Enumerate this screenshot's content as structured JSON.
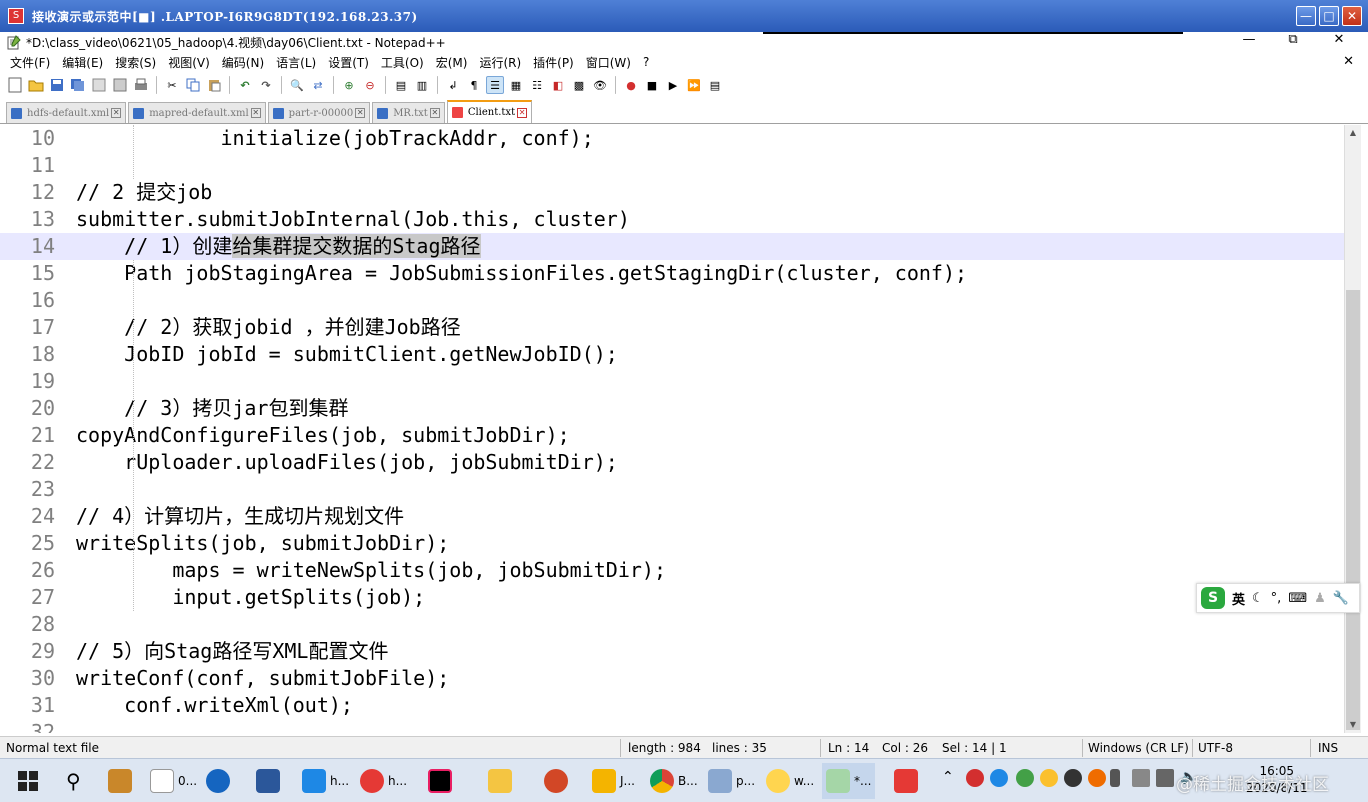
{
  "remote_window": {
    "title": "接收演示或示范中[■] .LAPTOP-I6R9G8DT(192.168.23.37)"
  },
  "window": {
    "title": "*D:\\class_video\\0621\\05_hadoop\\4.视频\\day06\\Client.txt - Notepad++"
  },
  "menu": [
    "文件(F)",
    "编辑(E)",
    "搜索(S)",
    "视图(V)",
    "编码(N)",
    "语言(L)",
    "设置(T)",
    "工具(O)",
    "宏(M)",
    "运行(R)",
    "插件(P)",
    "窗口(W)",
    "?"
  ],
  "tabs": [
    {
      "label": "hdfs-default.xml",
      "active": false
    },
    {
      "label": "mapred-default.xml",
      "active": false
    },
    {
      "label": "part-r-00000",
      "active": false
    },
    {
      "label": "MR.txt",
      "active": false
    },
    {
      "label": "Client.txt",
      "active": true
    }
  ],
  "editor": {
    "lines": [
      {
        "n": "10",
        "text": "            initialize(jobTrackAddr, conf);"
      },
      {
        "n": "11",
        "text": ""
      },
      {
        "n": "12",
        "text": "// 2 提交job"
      },
      {
        "n": "13",
        "text": "submitter.submitJobInternal(Job.this, cluster)"
      },
      {
        "n": "14",
        "pre": "    // 1）创建",
        "sel": "给集群提交数据的Stag路径",
        "post": ""
      },
      {
        "n": "15",
        "text": "    Path jobStagingArea = JobSubmissionFiles.getStagingDir(cluster, conf);"
      },
      {
        "n": "16",
        "text": ""
      },
      {
        "n": "17",
        "text": "    // 2）获取jobid ，并创建Job路径"
      },
      {
        "n": "18",
        "text": "    JobID jobId = submitClient.getNewJobID();"
      },
      {
        "n": "19",
        "text": ""
      },
      {
        "n": "20",
        "text": "    // 3）拷贝jar包到集群"
      },
      {
        "n": "21",
        "text": "copyAndConfigureFiles(job, submitJobDir);"
      },
      {
        "n": "22",
        "text": "    rUploader.uploadFiles(job, jobSubmitDir);"
      },
      {
        "n": "23",
        "text": ""
      },
      {
        "n": "24",
        "text": "// 4）计算切片，生成切片规划文件"
      },
      {
        "n": "25",
        "text": "writeSplits(job, submitJobDir);"
      },
      {
        "n": "26",
        "text": "        maps = writeNewSplits(job, jobSubmitDir);"
      },
      {
        "n": "27",
        "text": "        input.getSplits(job);"
      },
      {
        "n": "28",
        "text": ""
      },
      {
        "n": "29",
        "text": "// 5）向Stag路径写XML配置文件"
      },
      {
        "n": "30",
        "text": "writeConf(conf, submitJobFile);"
      },
      {
        "n": "31",
        "text": "    conf.writeXml(out);"
      },
      {
        "n": "32",
        "text": ""
      }
    ]
  },
  "ime": {
    "lang": "英"
  },
  "status": {
    "file_type": "Normal text file",
    "length": "length : 984",
    "lines": "lines : 35",
    "ln": "Ln : 14",
    "col": "Col : 26",
    "sel": "Sel : 14 | 1",
    "eol": "Windows (CR LF)",
    "encoding": "UTF-8",
    "mode": "INS"
  },
  "taskbar": {
    "items": [
      {
        "label": "0...",
        "color": "#ffffff"
      },
      {
        "label": "h...",
        "color": "#1e88e5"
      },
      {
        "label": "h...",
        "color": "#e53935"
      },
      {
        "label": "J...",
        "color": "#f4b400"
      },
      {
        "label": "B...",
        "color": "#4caf50"
      },
      {
        "label": "p...",
        "color": "#8aa8d0"
      },
      {
        "label": "w...",
        "color": "#ffd54f"
      },
      {
        "label": "*...",
        "color": "#a5d6a7"
      }
    ],
    "time": "16:05",
    "date": "2020/8/11",
    "watermark": "@稀土掘金技术社区"
  }
}
